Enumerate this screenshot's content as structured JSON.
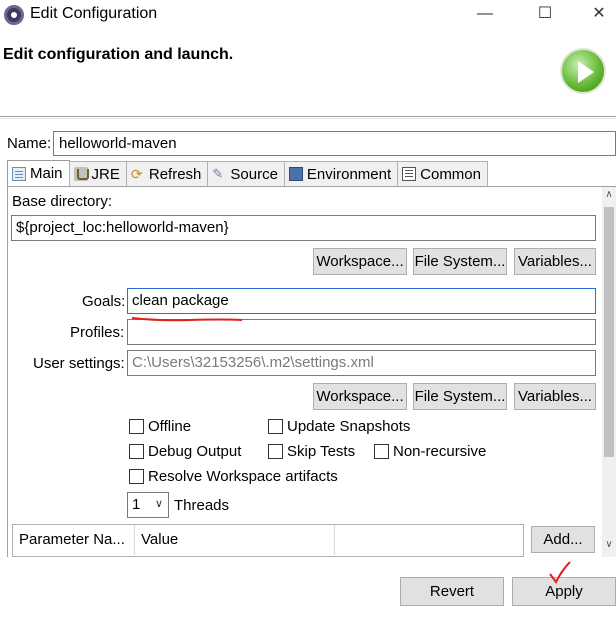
{
  "window": {
    "title": "Edit Configuration",
    "min_glyph": "—",
    "max_glyph": "☐",
    "close_glyph": "✕"
  },
  "header": {
    "title": "Edit configuration and launch."
  },
  "name": {
    "label": "Name:",
    "value": "helloworld-maven"
  },
  "tabs": [
    {
      "label": "Main",
      "icon": "main-tab-icon",
      "active": true
    },
    {
      "label": "JRE",
      "icon": "jre-icon"
    },
    {
      "label": "Refresh",
      "icon": "refresh-icon"
    },
    {
      "label": "Source",
      "icon": "source-icon"
    },
    {
      "label": "Environment",
      "icon": "environment-icon"
    },
    {
      "label": "Common",
      "icon": "common-icon"
    }
  ],
  "main": {
    "base_dir_label": "Base directory:",
    "base_dir_value": "${project_loc:helloworld-maven}",
    "workspace_btn": "Workspace...",
    "filesystem_btn": "File System...",
    "variables_btn": "Variables...",
    "goals_label": "Goals:",
    "goals_value": "clean package",
    "profiles_label": "Profiles:",
    "profiles_value": "",
    "user_settings_label": "User settings:",
    "user_settings_value": "C:\\Users\\32153256\\.m2\\settings.xml",
    "options": {
      "offline": "Offline",
      "update_snapshots": "Update Snapshots",
      "debug_output": "Debug Output",
      "skip_tests": "Skip Tests",
      "non_recursive": "Non-recursive",
      "resolve_workspace": "Resolve Workspace artifacts"
    },
    "threads_value": "1",
    "threads_label": "Threads",
    "param_table": {
      "columns": [
        "Parameter Na...",
        "Value"
      ]
    },
    "add_btn": "Add..."
  },
  "footer": {
    "revert_btn": "Revert",
    "apply_btn": "Apply"
  },
  "colors": {
    "annotation_red": "#e0201a",
    "focus_blue": "#2a6fd6"
  }
}
